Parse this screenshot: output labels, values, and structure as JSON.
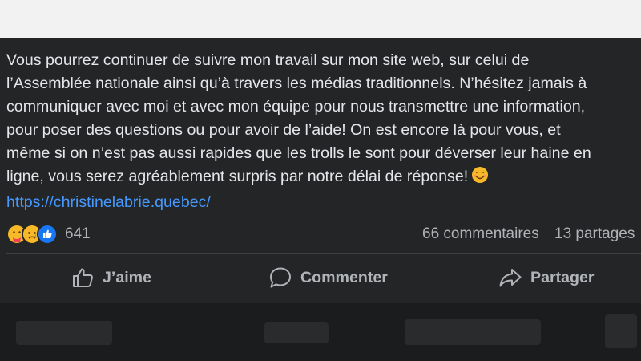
{
  "post": {
    "lines": [
      "Vous pourrez continuer de suivre mon travail sur mon site web, sur celui de",
      "l’Assemblée nationale ainsi qu’à travers les médias traditionnels. N’hésitez jamais à",
      "communiquer avec moi et avec mon équipe pour nous transmettre une information,",
      "pour poser des questions ou pour avoir de l’aide! On est encore là pour vous, et",
      "même si on n’est pas aussi rapides que les trolls le sont pour déverser leur haine en",
      "ligne, vous serez agréablement surpris par notre délai de réponse!"
    ],
    "link": "https://christinelabrie.quebec/"
  },
  "reactions": {
    "icons": [
      "care-reaction-icon",
      "sad-reaction-icon",
      "like-reaction-icon"
    ],
    "count": "641"
  },
  "stats": {
    "comments": "66 commentaires",
    "shares": "13 partages"
  },
  "actions": {
    "like": "J’aime",
    "comment": "Commenter",
    "share": "Partager"
  },
  "colors": {
    "card_bg": "#242526",
    "text": "#e4e6eb",
    "secondary_text": "#b0b3b8",
    "link": "#4599ff",
    "like_blue": "#1877f2"
  }
}
